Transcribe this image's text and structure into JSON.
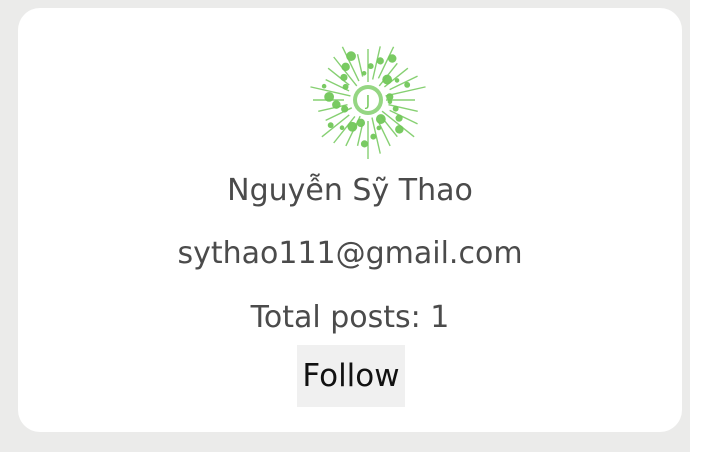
{
  "profile": {
    "name": "Nguyễn Sỹ Thao",
    "email": "sythao111@gmail.com",
    "posts_text": "Total posts: 1",
    "follow_label": "Follow",
    "avatar_letter": "J",
    "avatar_icon": "starburst-avatar-icon",
    "colors": {
      "avatar_green": "#72c85a",
      "card_bg": "#ffffff",
      "page_bg": "#ebebea",
      "text": "#4b4b4b",
      "button_bg": "#f0f0f0"
    }
  }
}
